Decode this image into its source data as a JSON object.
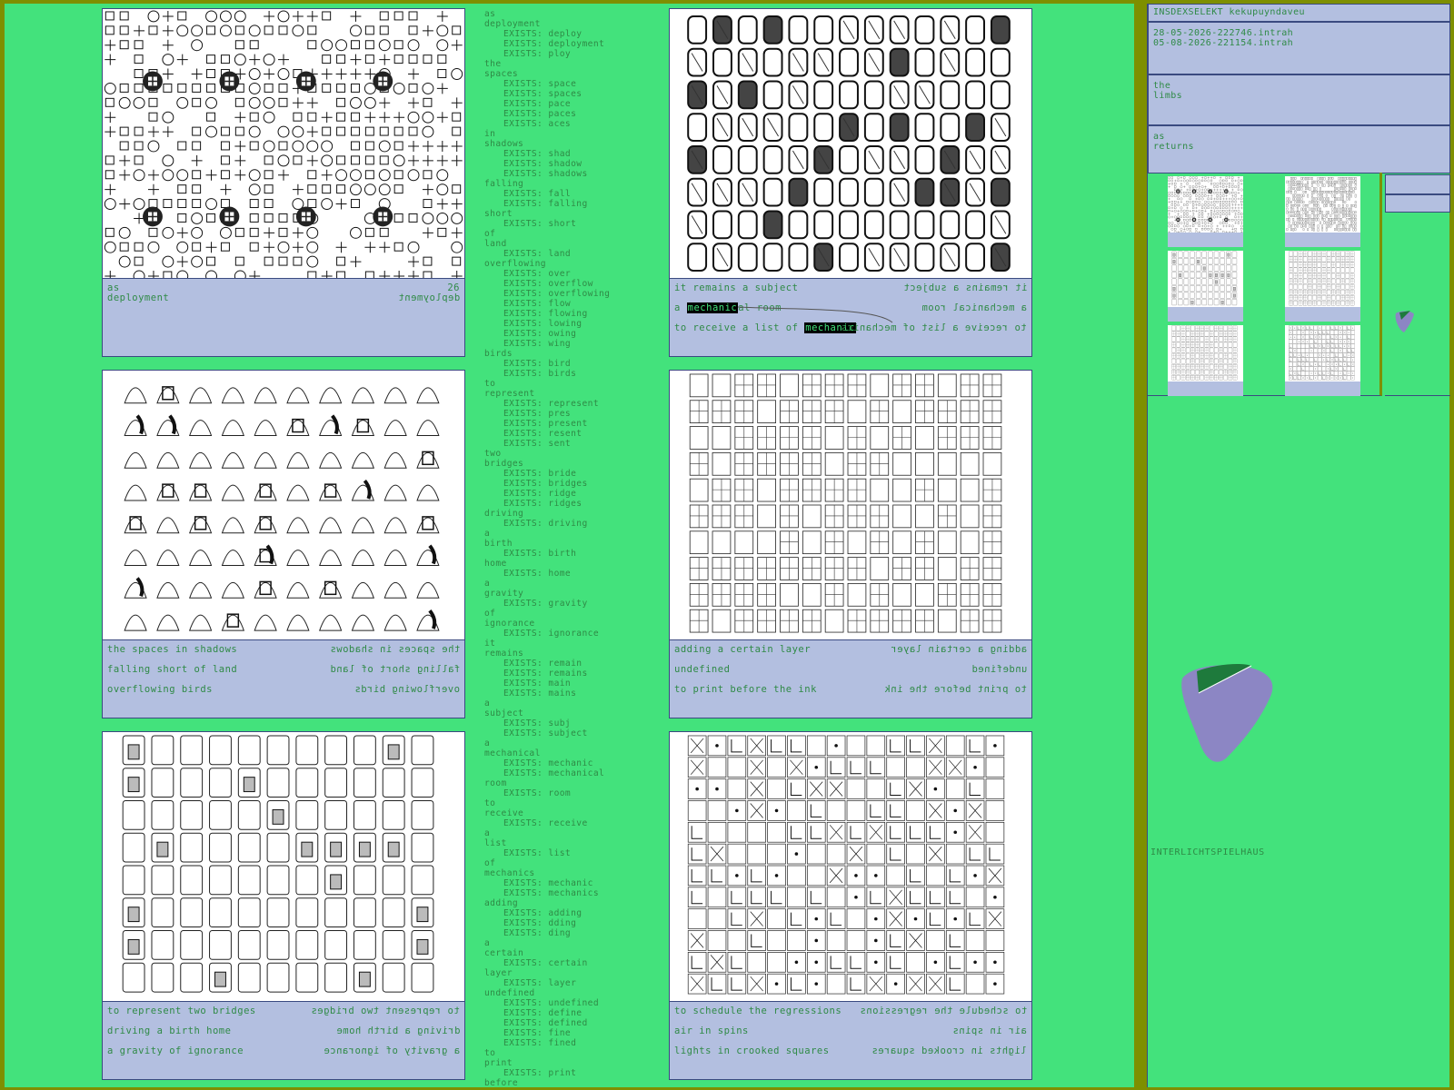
{
  "tiles": [
    {
      "pattern": "ornament-grid",
      "caption_lines": [
        {
          "left": "as",
          "right": "as"
        },
        {
          "left": "deployment",
          "right": "deployment"
        }
      ]
    },
    {
      "pattern": "thick-blocks",
      "caption_lines": [
        {
          "left": "it remains a subject",
          "right": "it remains a subject"
        },
        {
          "left": "a mechanical room",
          "right": "a mechanical room"
        },
        {
          "left": "to receive a list of",
          "right": "to receive a list of mechanics"
        }
      ],
      "highlights": [
        "mechanic",
        "mechanic"
      ]
    },
    {
      "pattern": "lamp-shapes",
      "caption_lines": [
        {
          "left": "the spaces in shadows",
          "right": "the spaces in shadows"
        },
        {
          "left": "falling short of land",
          "right": "falling short of land"
        },
        {
          "left": "overflowing birds",
          "right": "overflowing birds"
        }
      ]
    },
    {
      "pattern": "window-grid",
      "caption_lines": [
        {
          "left": "adding a certain layer",
          "right": "adding a certain layer"
        },
        {
          "left": "undefined",
          "right": "undefined"
        },
        {
          "left": "to print before the ink",
          "right": "to print before the ink"
        }
      ]
    },
    {
      "pattern": "door-shapes",
      "caption_lines": [
        {
          "left": "to represent two bridges",
          "right": "to represent two bridges"
        },
        {
          "left": "driving a birth home",
          "right": "driving a birth home"
        },
        {
          "left": "a gravity of ignorance",
          "right": "a gravity of ignorance"
        }
      ]
    },
    {
      "pattern": "maze-grid",
      "caption_lines": [
        {
          "left": "to schedule the regressions",
          "right": "to schedule the regressions"
        },
        {
          "left": "air in spins",
          "right": "air in spins"
        },
        {
          "left": "lights in crooked squares",
          "right": "lights in crooked squares"
        }
      ]
    }
  ],
  "word_list": [
    {
      "w": "as"
    },
    {
      "w": "deployment"
    },
    {
      "e": "EXISTS: deploy"
    },
    {
      "e": "EXISTS: deployment"
    },
    {
      "e": "EXISTS: ploy"
    },
    {
      "w": "the"
    },
    {
      "w": "spaces"
    },
    {
      "e": "EXISTS: space"
    },
    {
      "e": "EXISTS: spaces"
    },
    {
      "e": "EXISTS: pace"
    },
    {
      "e": "EXISTS: paces"
    },
    {
      "e": "EXISTS: aces"
    },
    {
      "w": "in"
    },
    {
      "w": "shadows"
    },
    {
      "e": "EXISTS: shad"
    },
    {
      "e": "EXISTS: shadow"
    },
    {
      "e": "EXISTS: shadows"
    },
    {
      "w": "falling"
    },
    {
      "e": "EXISTS: fall"
    },
    {
      "e": "EXISTS: falling"
    },
    {
      "w": "short"
    },
    {
      "e": "EXISTS: short"
    },
    {
      "w": "of"
    },
    {
      "w": "land"
    },
    {
      "e": "EXISTS: land"
    },
    {
      "w": "overflowing"
    },
    {
      "e": "EXISTS: over"
    },
    {
      "e": "EXISTS: overflow"
    },
    {
      "e": "EXISTS: overflowing"
    },
    {
      "e": "EXISTS: flow"
    },
    {
      "e": "EXISTS: flowing"
    },
    {
      "e": "EXISTS: lowing"
    },
    {
      "e": "EXISTS: owing"
    },
    {
      "e": "EXISTS: wing"
    },
    {
      "w": "birds"
    },
    {
      "e": "EXISTS: bird"
    },
    {
      "e": "EXISTS: birds"
    },
    {
      "w": "to"
    },
    {
      "w": "represent"
    },
    {
      "e": "EXISTS: represent"
    },
    {
      "e": "EXISTS: pres"
    },
    {
      "e": "EXISTS: present"
    },
    {
      "e": "EXISTS: resent"
    },
    {
      "e": "EXISTS: sent"
    },
    {
      "w": "two"
    },
    {
      "w": "bridges"
    },
    {
      "e": "EXISTS: bride"
    },
    {
      "e": "EXISTS: bridges"
    },
    {
      "e": "EXISTS: ridge"
    },
    {
      "e": "EXISTS: ridges"
    },
    {
      "w": "driving"
    },
    {
      "e": "EXISTS: driving"
    },
    {
      "w": "a"
    },
    {
      "w": "birth"
    },
    {
      "e": "EXISTS: birth"
    },
    {
      "w": "home"
    },
    {
      "e": "EXISTS: home"
    },
    {
      "w": "a"
    },
    {
      "w": "gravity"
    },
    {
      "e": "EXISTS: gravity"
    },
    {
      "w": "of"
    },
    {
      "w": "ignorance"
    },
    {
      "e": "EXISTS: ignorance"
    },
    {
      "w": "it"
    },
    {
      "w": "remains"
    },
    {
      "e": "EXISTS: remain"
    },
    {
      "e": "EXISTS: remains"
    },
    {
      "e": "EXISTS: main"
    },
    {
      "e": "EXISTS: mains"
    },
    {
      "w": "a"
    },
    {
      "w": "subject"
    },
    {
      "e": "EXISTS: subj"
    },
    {
      "e": "EXISTS: subject"
    },
    {
      "w": "a"
    },
    {
      "w": "mechanical"
    },
    {
      "e": "EXISTS: mechanic"
    },
    {
      "e": "EXISTS: mechanical"
    },
    {
      "w": "room"
    },
    {
      "e": "EXISTS: room"
    },
    {
      "w": "to"
    },
    {
      "w": "receive"
    },
    {
      "e": "EXISTS: receive"
    },
    {
      "w": "a"
    },
    {
      "w": "list"
    },
    {
      "e": "EXISTS: list"
    },
    {
      "w": "of"
    },
    {
      "w": "mechanics"
    },
    {
      "e": "EXISTS: mechanic"
    },
    {
      "e": "EXISTS: mechanics"
    },
    {
      "w": "adding"
    },
    {
      "e": "EXISTS: adding"
    },
    {
      "e": "EXISTS: dding"
    },
    {
      "e": "EXISTS: ding"
    },
    {
      "w": "a"
    },
    {
      "w": "certain"
    },
    {
      "e": "EXISTS: certain"
    },
    {
      "w": "layer"
    },
    {
      "e": "EXISTS: layer"
    },
    {
      "w": "undefined"
    },
    {
      "e": "EXISTS: undefined"
    },
    {
      "e": "EXISTS: define"
    },
    {
      "e": "EXISTS: defined"
    },
    {
      "e": "EXISTS: fine"
    },
    {
      "e": "EXISTS: fined"
    },
    {
      "w": "to"
    },
    {
      "w": "print"
    },
    {
      "e": "EXISTS: print"
    },
    {
      "w": "before"
    }
  ],
  "sidebar": {
    "title": "INSDEXSELEKT kekupuyndaveu",
    "files": [
      "28-05-2026-222746.intrah",
      "05-08-2026-221154.intrah"
    ],
    "box2": [
      "the",
      "limbs"
    ],
    "box3": [
      "as",
      "returns"
    ],
    "footer": "INTERLICHTSPIELHAUS"
  },
  "thumbnails": [
    "ornament-grid",
    "dense-script",
    "door-shapes",
    "window-grid",
    "window-grid",
    "maze-grid"
  ],
  "colors": {
    "background": "#7e8f00",
    "panel_green": "#43e27c",
    "caption_blue": "#b3bfe0",
    "text_green": "#2f8a46",
    "blob_purple": "#8c86c4",
    "blob_dark": "#1e7a3c"
  }
}
